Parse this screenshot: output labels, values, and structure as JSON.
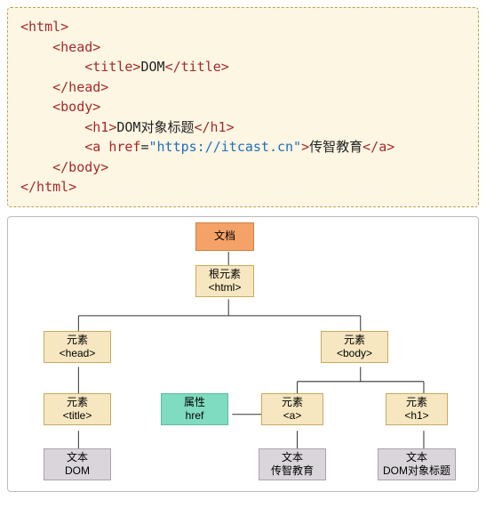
{
  "code": {
    "indent": "    ",
    "tags": {
      "html_open": "<html>",
      "html_close": "</html>",
      "head_open": "<head>",
      "head_close": "</head>",
      "title_open": "<title>",
      "title_text": "DOM",
      "title_close": "</title>",
      "body_open": "<body>",
      "body_close": "</body>",
      "h1_open": "<h1>",
      "h1_text": "DOM对象标题",
      "h1_close": "</h1>",
      "a_open1": "<a ",
      "a_attr": "href",
      "a_eq": "=",
      "a_val": "\"https://itcast.cn\"",
      "a_open2": ">",
      "a_text": "传智教育",
      "a_close": "</a>"
    }
  },
  "tree": {
    "doc": "文档",
    "root_l1": "根元素",
    "root_l2": "<html>",
    "head_l1": "元素",
    "head_l2": "<head>",
    "body_l1": "元素",
    "body_l2": "<body>",
    "title_l1": "元素",
    "title_l2": "<title>",
    "attr_l1": "属性",
    "attr_l2": "href",
    "a_l1": "元素",
    "a_l2": "<a>",
    "h1_l1": "元素",
    "h1_l2": "<h1>",
    "text_dom_l1": "文本",
    "text_dom_l2": "DOM",
    "text_cz_l1": "文本",
    "text_cz_l2": "传智教育",
    "text_h1_l1": "文本",
    "text_h1_l2": "DOM对象标题"
  }
}
